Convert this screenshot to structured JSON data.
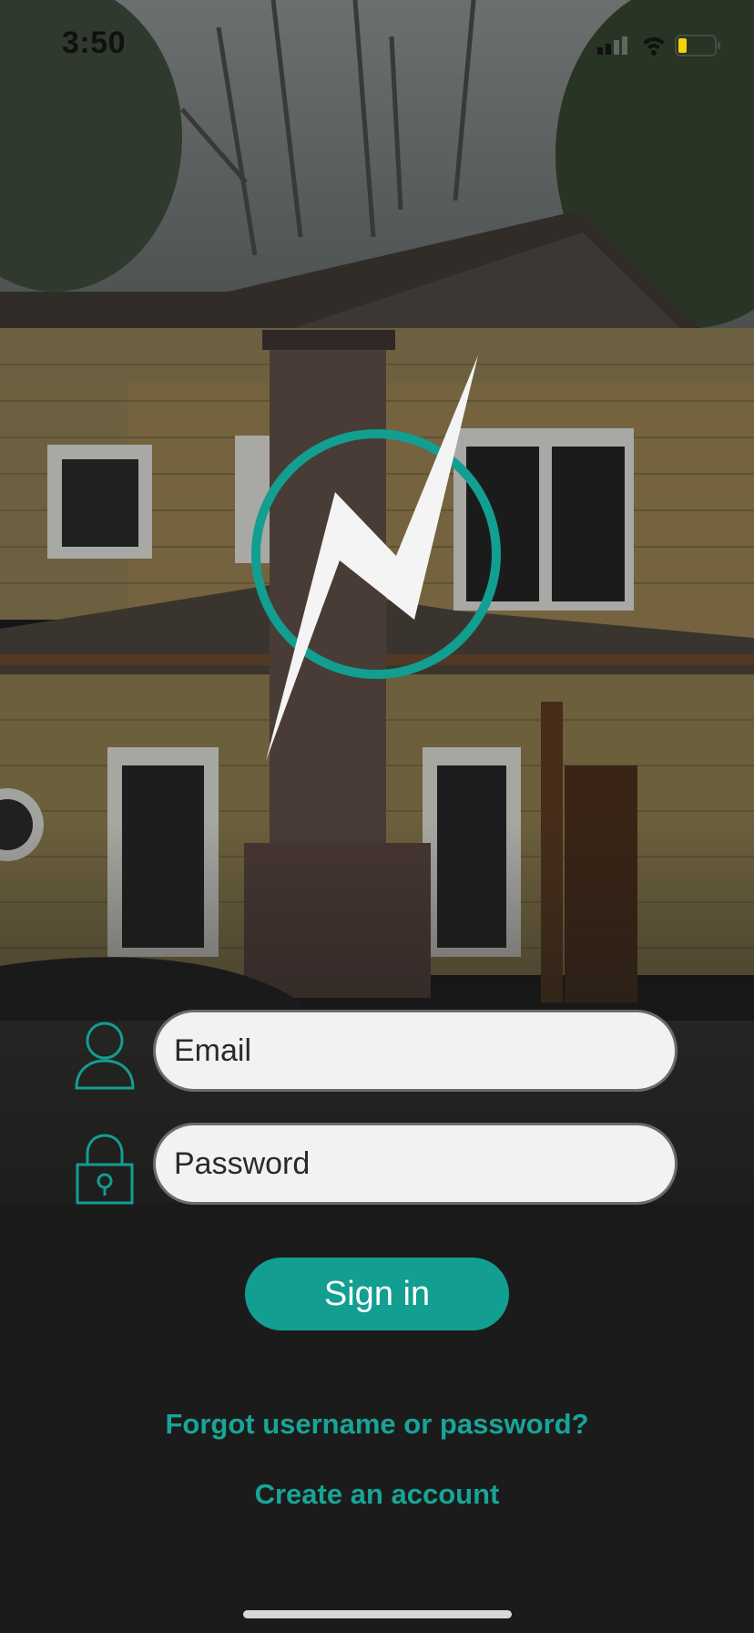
{
  "status_bar": {
    "time": "3:50",
    "icons": [
      "cellular-signal-icon",
      "wifi-icon",
      "battery-low-icon"
    ],
    "battery_color": "#f2d20c"
  },
  "background": {
    "description_icon": "house-photo"
  },
  "logo": {
    "icon": "lightning-bolt-logo",
    "ring_color": "#129e90",
    "bolt_color": "#f4f4f4"
  },
  "form": {
    "email": {
      "placeholder": "Email",
      "value": "",
      "icon": "user-icon"
    },
    "password": {
      "placeholder": "Password",
      "value": "",
      "icon": "lock-icon"
    },
    "sign_in_label": "Sign in"
  },
  "links": {
    "forgot": "Forgot username or password?",
    "create": "Create an account"
  },
  "colors": {
    "accent": "#129e90",
    "link": "#17a597",
    "dark_bg": "#1b1b1b"
  }
}
